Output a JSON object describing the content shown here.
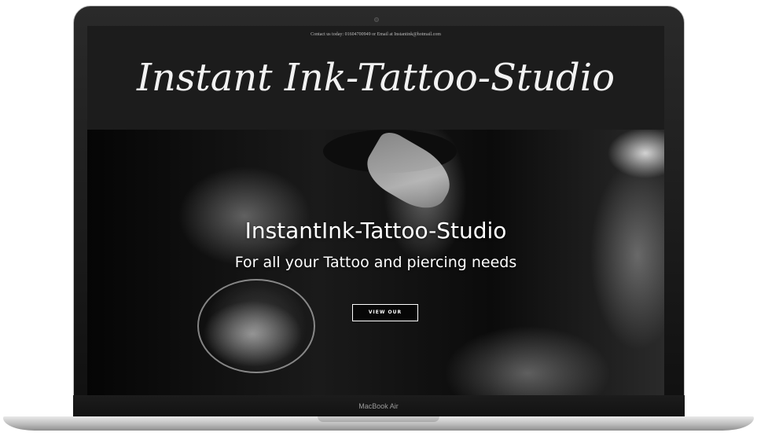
{
  "device": {
    "brand_label": "MacBook Air"
  },
  "site": {
    "contact_text": "Contact us today: 01604700949 or Email at Instantink@hotmail.com",
    "logo_title": "Instant Ink-Tattoo-Studio",
    "hero": {
      "title": "InstantInk-Tattoo-Studio",
      "subtitle": "For all your Tattoo and piercing needs",
      "button_label": "VIEW OUR"
    }
  },
  "colors": {
    "header_bg": "#1c1c1c",
    "text_light": "#ffffff",
    "frame": "#0f0f0f"
  }
}
